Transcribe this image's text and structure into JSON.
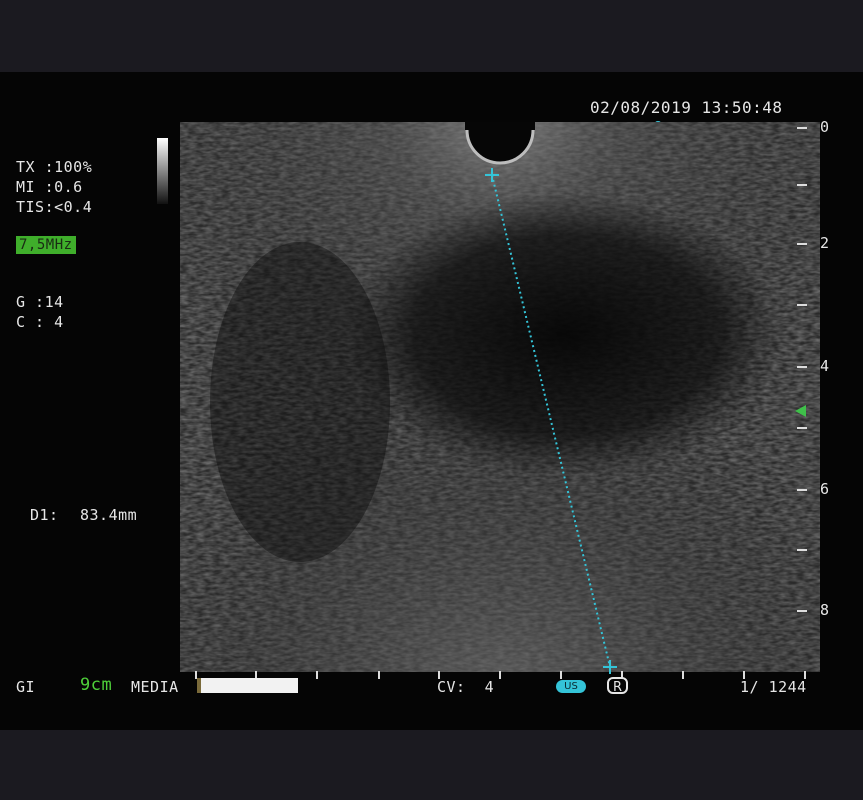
{
  "header": {
    "datetime": "02/08/2019 13:50:48"
  },
  "params": {
    "tx": "TX :100%",
    "mi": "MI :0.6",
    "tis": "TIS:<0.4",
    "frequency": "7,5MHz",
    "gain": "G :14",
    "contrast": "C : 4"
  },
  "measurement": {
    "label": "D1:",
    "value": "83.4mm"
  },
  "depth_scale": [
    "0",
    "2",
    "4",
    "6",
    "8"
  ],
  "footer": {
    "preset": "GI",
    "depth": "9cm",
    "media_label": "MEDIA",
    "cv": "CV:  4",
    "us_badge": "US",
    "r_badge": "R",
    "frame": "1/ 1244"
  },
  "colors": {
    "frequency_bg": "#3fae2b",
    "depth_text": "#4fd13a",
    "caliper": "#34c4d8",
    "focus_marker": "#3fc04a"
  }
}
